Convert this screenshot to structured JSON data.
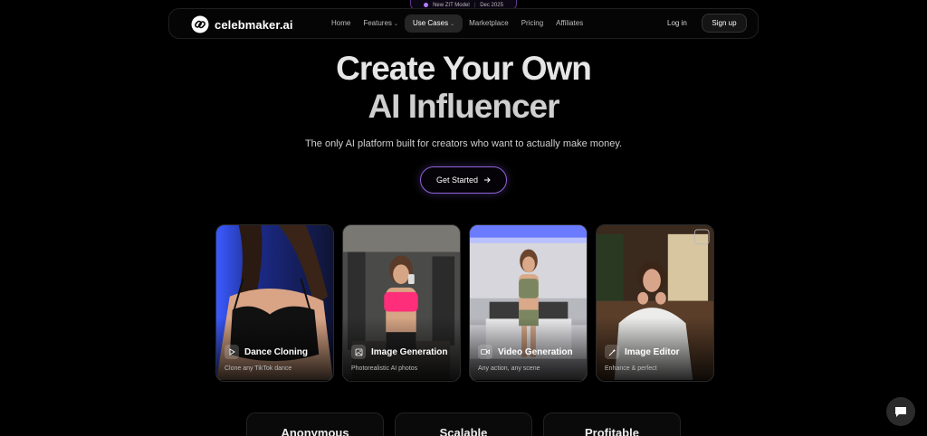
{
  "announcement": {
    "label": "New ZIT Model",
    "date": "Dec 2025"
  },
  "brand": {
    "name": "celebmaker.ai",
    "accent": "#8e63d9"
  },
  "nav": {
    "links": [
      {
        "label": "Home"
      },
      {
        "label": "Features"
      },
      {
        "label": "Use Cases"
      },
      {
        "label": "Marketplace"
      },
      {
        "label": "Pricing"
      },
      {
        "label": "Affiliates"
      }
    ],
    "login": "Log in",
    "signup": "Sign up"
  },
  "hero": {
    "title_line1": "Create Your Own",
    "title_line2": "AI Influencer",
    "subtitle": "The only AI platform built for creators who want to actually make money.",
    "cta": "Get Started"
  },
  "cards": [
    {
      "title": "Dance Cloning",
      "desc": "Clone any TikTok dance",
      "icon": "play-icon"
    },
    {
      "title": "Image Generation",
      "desc": "Photorealistic AI photos",
      "icon": "image-icon"
    },
    {
      "title": "Video Generation",
      "desc": "Any action, any scene",
      "icon": "video-icon"
    },
    {
      "title": "Image Editor",
      "desc": "Enhance & perfect",
      "icon": "magic-wand-icon"
    }
  ],
  "features": [
    {
      "label": "Anonymous"
    },
    {
      "label": "Scalable"
    },
    {
      "label": "Profitable"
    }
  ]
}
